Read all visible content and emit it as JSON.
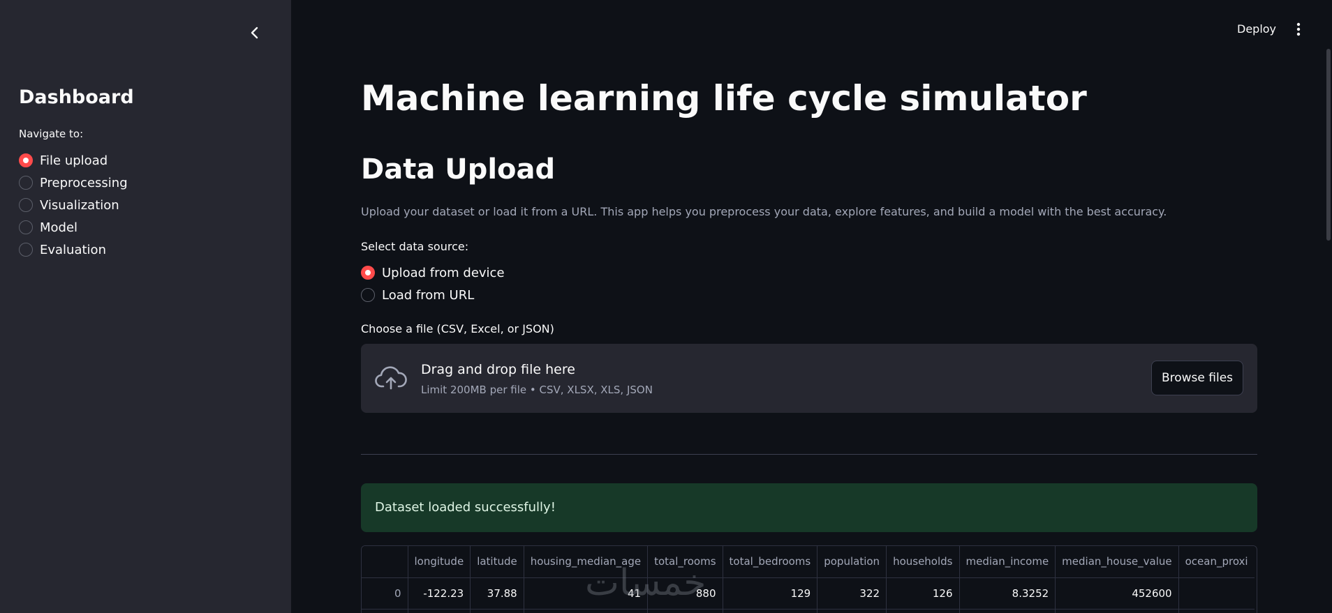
{
  "sidebar": {
    "title": "Dashboard",
    "nav_label": "Navigate to:",
    "items": [
      {
        "label": "File upload",
        "selected": true
      },
      {
        "label": "Preprocessing",
        "selected": false
      },
      {
        "label": "Visualization",
        "selected": false
      },
      {
        "label": "Model",
        "selected": false
      },
      {
        "label": "Evaluation",
        "selected": false
      }
    ]
  },
  "header": {
    "deploy_label": "Deploy"
  },
  "main": {
    "title": "Machine learning life cycle simulator",
    "section_title": "Data Upload",
    "description": "Upload your dataset or load it from a URL. This app helps you preprocess your data, explore features, and build a model with the best accuracy.",
    "source_label": "Select data source:",
    "source_options": [
      {
        "label": "Upload from device",
        "selected": true
      },
      {
        "label": "Load from URL",
        "selected": false
      }
    ],
    "file_label": "Choose a file (CSV, Excel, or JSON)",
    "dropzone": {
      "title": "Drag and drop file here",
      "limit": "Limit 200MB per file • CSV, XLSX, XLS, JSON",
      "browse_label": "Browse files"
    },
    "success_message": "Dataset loaded successfully!",
    "table": {
      "columns": [
        "",
        "longitude",
        "latitude",
        "housing_median_age",
        "total_rooms",
        "total_bedrooms",
        "population",
        "households",
        "median_income",
        "median_house_value",
        "ocean_proxi"
      ],
      "rows": [
        [
          "0",
          "-122.23",
          "37.88",
          "41",
          "880",
          "129",
          "322",
          "126",
          "8.3252",
          "452600",
          ""
        ]
      ]
    },
    "watermark": "خمسات"
  },
  "colors": {
    "accent": "#ff4b4b",
    "sidebar_bg": "#262730",
    "main_bg": "#0e1117",
    "success_bg": "#173928"
  }
}
